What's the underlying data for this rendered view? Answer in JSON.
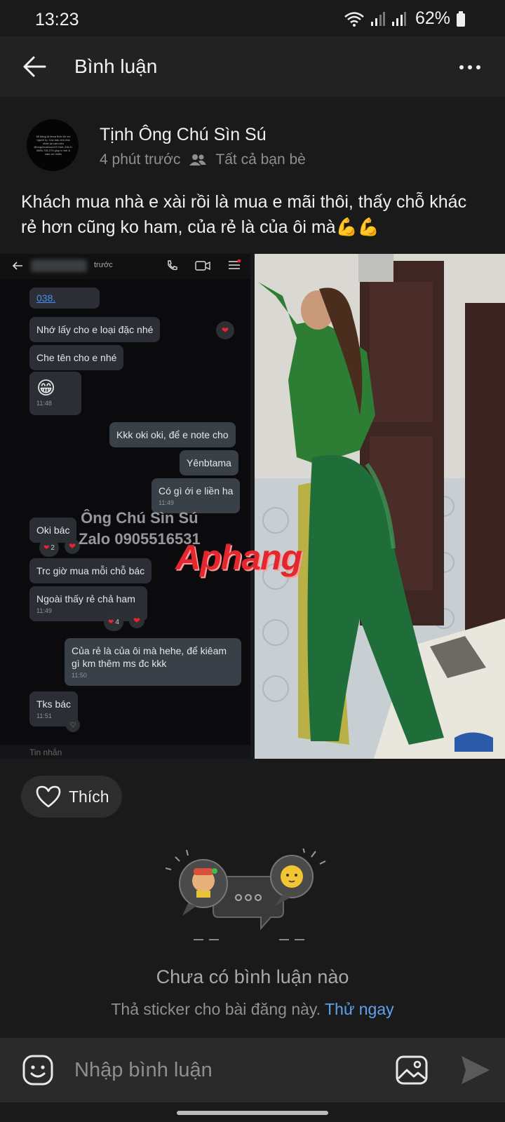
{
  "status_bar": {
    "time": "13:23",
    "battery": "62%"
  },
  "header": {
    "title": "Bình luận"
  },
  "post": {
    "author": "Tịnh Ông Chú Sìn Sú",
    "timestamp": "4 phút trước",
    "audience": "Tất cả bạn bè",
    "text": "Khách mua nhà e xài rồi là mua e mãi thôi, thấy chỗ khác rẻ hơn cũng ko ham, của rẻ là của ôi mà💪💪",
    "avatar_text": "Mỉ đang là khoa thôn tin vui người tụ. Các bác chủ nhà nhấn lại cam kèo @ongchusinsu123 Hotl: ZALO: 0890.726.270 giúp e nhé & cảm ơn nhiều",
    "screenshot": {
      "top_time": "trước",
      "messages": [
        {
          "text": "038.",
          "link": true
        },
        {
          "text": "Nhớ lấy cho e loại đặc nhé"
        },
        {
          "text": "Che tên cho e nhé"
        },
        {
          "text": "😁",
          "time": "11:48"
        },
        {
          "text": "Kkk oki oki, để e note cho"
        },
        {
          "text": "Yênbtama"
        },
        {
          "text": "Có gì ới e liền ha",
          "time": "11:49"
        },
        {
          "text": "Oki bác",
          "reactions": "2"
        },
        {
          "text": "Trc giờ mua mỗi chỗ bác"
        },
        {
          "text": "Ngoài thấy rẻ chả ham",
          "time": "11:49",
          "reactions": "4"
        },
        {
          "text": "Của rẻ là của ôi mà hehe, để kiêam gì km thêm ms đc kkk",
          "time": "11:50"
        },
        {
          "text": "Tks bác",
          "time": "11:51"
        }
      ],
      "input_placeholder": "Tin nhắn",
      "watermark_line1": "Ông Chú Sìn Sú",
      "watermark_line2": "Zalo 0905516531"
    },
    "brand_watermark": "Aphang"
  },
  "like_button": {
    "label": "Thích"
  },
  "empty_state": {
    "title": "Chưa có bình luận nào",
    "subtitle": "Thả sticker cho bài đăng này.",
    "action": "Thử ngay"
  },
  "composer": {
    "placeholder": "Nhập bình luận"
  },
  "icons": {
    "back": "arrow-left-icon",
    "more": "more-horizontal-icon",
    "friends": "friends-icon",
    "like": "heart-icon",
    "emoji": "emoji-icon",
    "image": "image-icon",
    "send": "send-icon"
  },
  "colors": {
    "background": "#1a1a1a",
    "header": "#222222",
    "accent": "#5ea1f0",
    "composer": "#2a2a2a"
  }
}
